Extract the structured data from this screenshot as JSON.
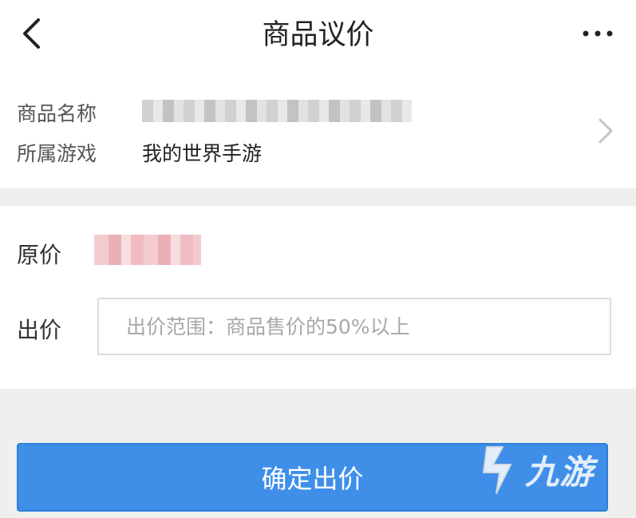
{
  "header": {
    "title": "商品议价",
    "back_icon": "chevron-left-icon",
    "more_icon": "more-horizontal-icon"
  },
  "product": {
    "name_label": "商品名称",
    "game_label": "所属游戏",
    "game_value": "我的世界手游",
    "chevron_icon": "chevron-right-icon"
  },
  "price": {
    "original_label": "原价",
    "bid_label": "出价",
    "bid_placeholder": "出价范围：商品售价的50%以上",
    "bid_value": ""
  },
  "actions": {
    "submit_label": "确定出价"
  },
  "watermark": {
    "text": "九游"
  },
  "colors": {
    "primary": "#3f8fe9",
    "background": "#efefef",
    "card": "#ffffff",
    "label_text": "#555555",
    "placeholder": "#a8a8a8"
  }
}
